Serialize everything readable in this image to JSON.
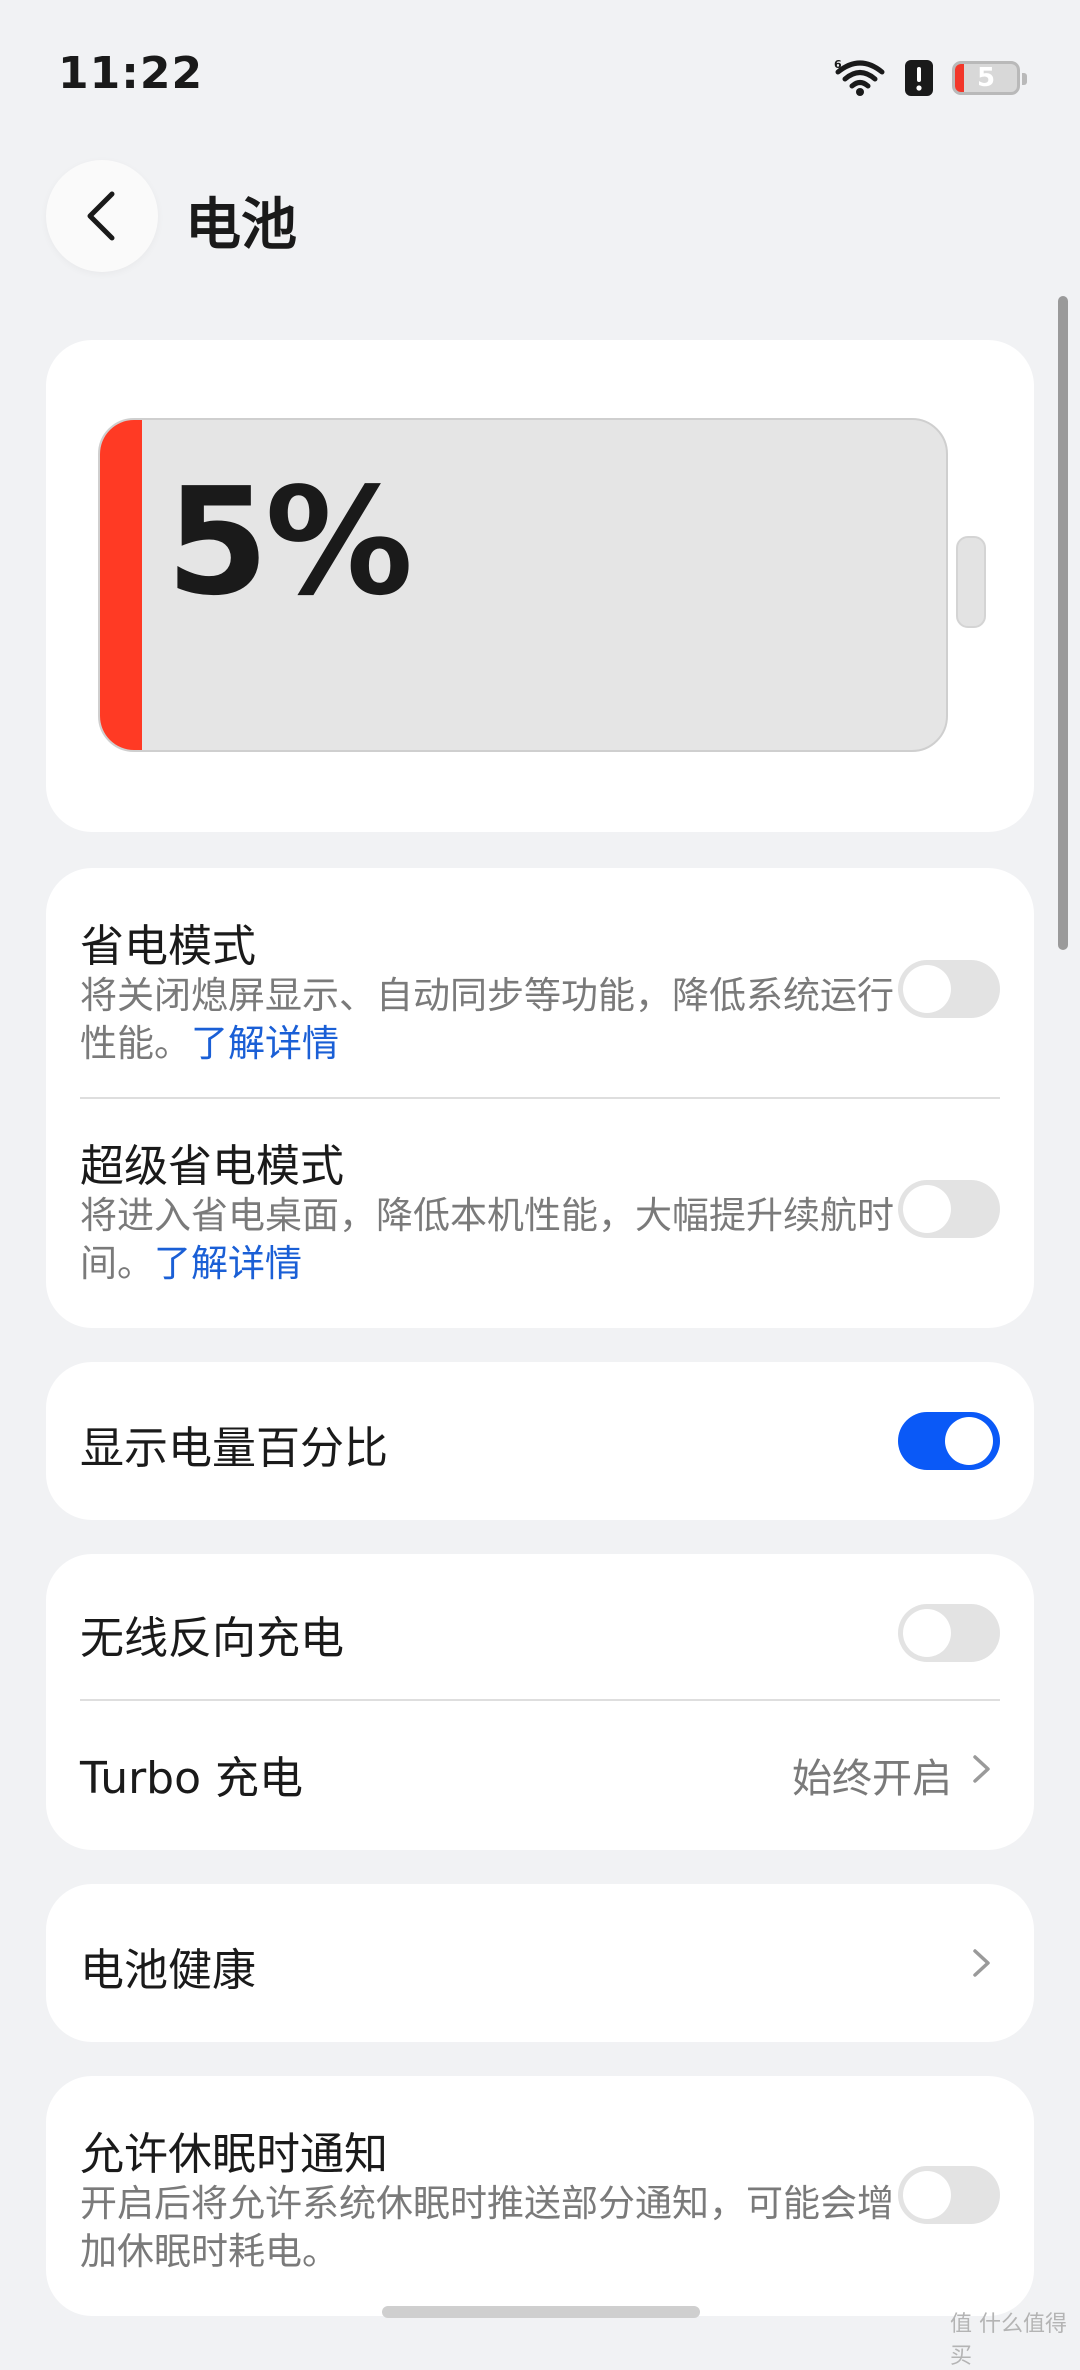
{
  "status_bar": {
    "time": "11:22",
    "icons": [
      "wifi-icon",
      "alert-icon"
    ],
    "battery_level": "5",
    "battery_fill_fraction": 0.05,
    "battery_low_color": "#f2372a"
  },
  "header": {
    "back_icon": "chevron-left-icon",
    "title": "电池"
  },
  "battery_card": {
    "percent_text": "5%",
    "level_fraction": 0.05,
    "level_color": "#ff3a24"
  },
  "power_saving": {
    "title": "省电模式",
    "desc": "将关闭熄屏显示、自动同步等功能，降低系统运行性能。",
    "link": "了解详情",
    "toggle": false
  },
  "super_power_saving": {
    "title": "超级省电模式",
    "desc": "将进入省电桌面，降低本机性能，大幅提升续航时间。",
    "link": "了解详情",
    "toggle": false
  },
  "show_percentage": {
    "title": "显示电量百分比",
    "toggle": true,
    "accent": "#0a59f7"
  },
  "reverse_charge": {
    "title": "无线反向充电",
    "toggle": false
  },
  "turbo": {
    "title": "Turbo 充电",
    "value": "始终开启"
  },
  "battery_health": {
    "title": "电池健康"
  },
  "sleep_notify": {
    "title": "允许休眠时通知",
    "desc": "开启后将允许系统休眠时推送部分通知，可能会增加休眠时耗电。",
    "toggle": false
  },
  "watermark": "值 什么值得买"
}
